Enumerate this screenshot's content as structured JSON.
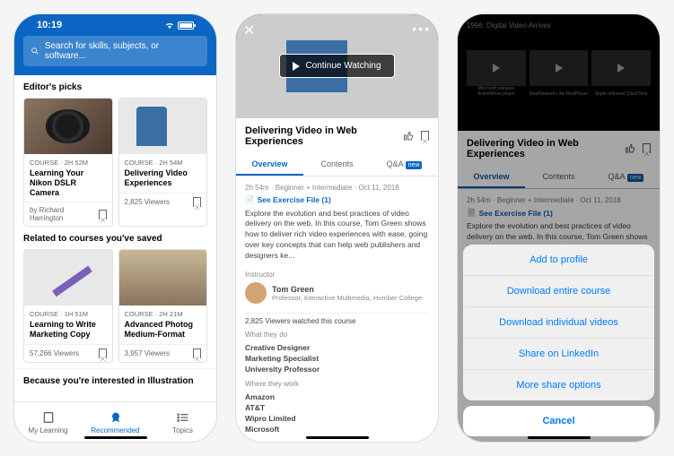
{
  "status_time": "10:19",
  "search": {
    "placeholder": "Search for skills, subjects, or software..."
  },
  "sections": {
    "editor_picks": "Editor's picks",
    "related": "Related to courses you've saved",
    "because": "Because you're interested in Illustration"
  },
  "cards": {
    "c1": {
      "meta": "COURSE · 2h 52m",
      "title": "Learning Your Nikon DSLR Camera",
      "by": "by Richard Harrington"
    },
    "c2": {
      "meta": "COURSE · 2h 54m",
      "title": "Delivering Video Experiences",
      "footer": "2,825 Viewers"
    },
    "c3": {
      "meta": "COURSE · 1h 51m",
      "title": "Learning to Write Marketing Copy",
      "footer": "57,266 Viewers"
    },
    "c4": {
      "meta": "COURSE · 2h 21m",
      "title": "Advanced Photog Medium-Format",
      "footer": "3,957 Viewers"
    }
  },
  "tabs": {
    "t1": "My Learning",
    "t2": "Recommended",
    "t3": "Topics"
  },
  "detail": {
    "continue": "Continue Watching",
    "title": "Delivering Video in Web Experiences",
    "tabs": {
      "t1": "Overview",
      "t2": "Contents",
      "t3": "Q&A",
      "badge": "new"
    },
    "meta": "2h 54m · Beginner + Intermediate · Oct 11, 2018",
    "exercise": "See Exercise File (1)",
    "desc": "Explore the evolution and best practices of video delivery on the web. In this course, Tom Green shows how to deliver rich video experiences with ease, going over key concepts that can help web publishers and designers ke...",
    "instructor_label": "Instructor",
    "instructor_name": "Tom Green",
    "instructor_role": "Professor, Interactive Multimedia, Humber College",
    "viewers": "2,825 Viewers watched this course",
    "what_label": "What they do",
    "roles": [
      "Creative Designer",
      "Marketing Specialist",
      "University Professor"
    ],
    "where_label": "Where they work",
    "companies": [
      "Amazon",
      "AT&T",
      "Wipro Limited",
      "Microsoft"
    ]
  },
  "timeline": {
    "title": "1996: Digital Video Arrives",
    "thumbs": [
      "Microsoft releases ActiveMovie player",
      "RealNetworks the RealPlayer",
      "Apple released QuickTime"
    ]
  },
  "sheet": {
    "items": [
      "Add to profile",
      "Download entire course",
      "Download individual videos",
      "Share on LinkedIn",
      "More share options"
    ],
    "cancel": "Cancel"
  }
}
